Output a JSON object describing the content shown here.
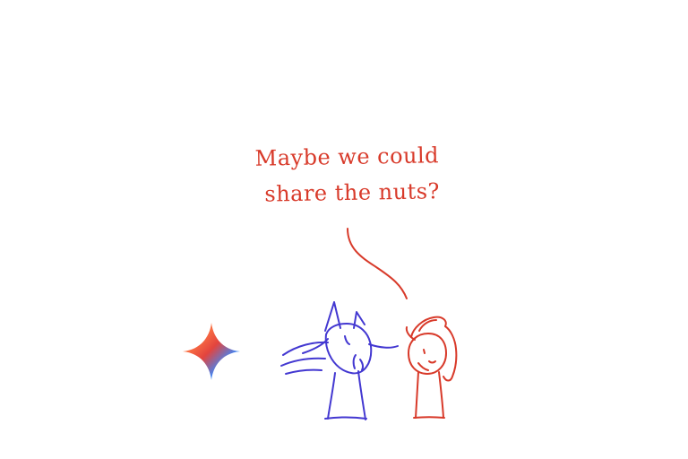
{
  "speech_bubble": {
    "line1": "Maybe we could",
    "line2": "share the nuts?"
  },
  "colors": {
    "background": "#ffffff",
    "speaker_red": "#d83a2a",
    "blue_character": "#4338d1",
    "red_character": "#d83a2a"
  },
  "icons": {
    "sparkle": "gradient-star-icon"
  }
}
